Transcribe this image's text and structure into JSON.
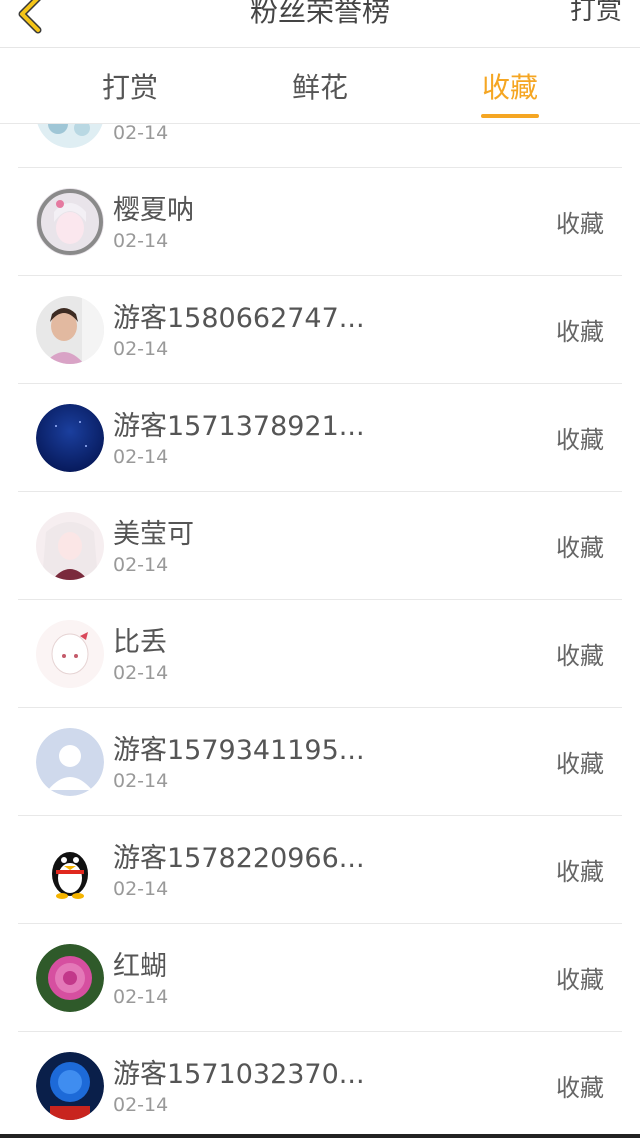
{
  "header": {
    "title": "粉丝荣誉榜",
    "action": "打赏"
  },
  "tabs": [
    {
      "label": "打赏",
      "active": false
    },
    {
      "label": "鲜花",
      "active": false
    },
    {
      "label": "收藏",
      "active": true
    }
  ],
  "partial_row": {
    "date": "02-14"
  },
  "rows": [
    {
      "name": "樱夏呐",
      "date": "02-14",
      "action": "收藏",
      "avatar": "anime-girl-avatar"
    },
    {
      "name": "游客1580662747...",
      "date": "02-14",
      "action": "收藏",
      "avatar": "child-photo-avatar"
    },
    {
      "name": "游客1571378921...",
      "date": "02-14",
      "action": "收藏",
      "avatar": "starry-sky-avatar"
    },
    {
      "name": "美莹可",
      "date": "02-14",
      "action": "收藏",
      "avatar": "anime-girl-avatar"
    },
    {
      "name": "比丢",
      "date": "02-14",
      "action": "收藏",
      "avatar": "chibi-avatar"
    },
    {
      "name": "游客1579341195...",
      "date": "02-14",
      "action": "收藏",
      "avatar": "default-user-avatar"
    },
    {
      "name": "游客1578220966...",
      "date": "02-14",
      "action": "收藏",
      "avatar": "qq-penguin-avatar"
    },
    {
      "name": "红蝴",
      "date": "02-14",
      "action": "收藏",
      "avatar": "pink-flower-avatar"
    },
    {
      "name": "游客1571032370...",
      "date": "02-14",
      "action": "收藏",
      "avatar": "blue-rose-avatar"
    }
  ],
  "colors": {
    "accent": "#f5a623",
    "divider": "#e8e8e8"
  }
}
